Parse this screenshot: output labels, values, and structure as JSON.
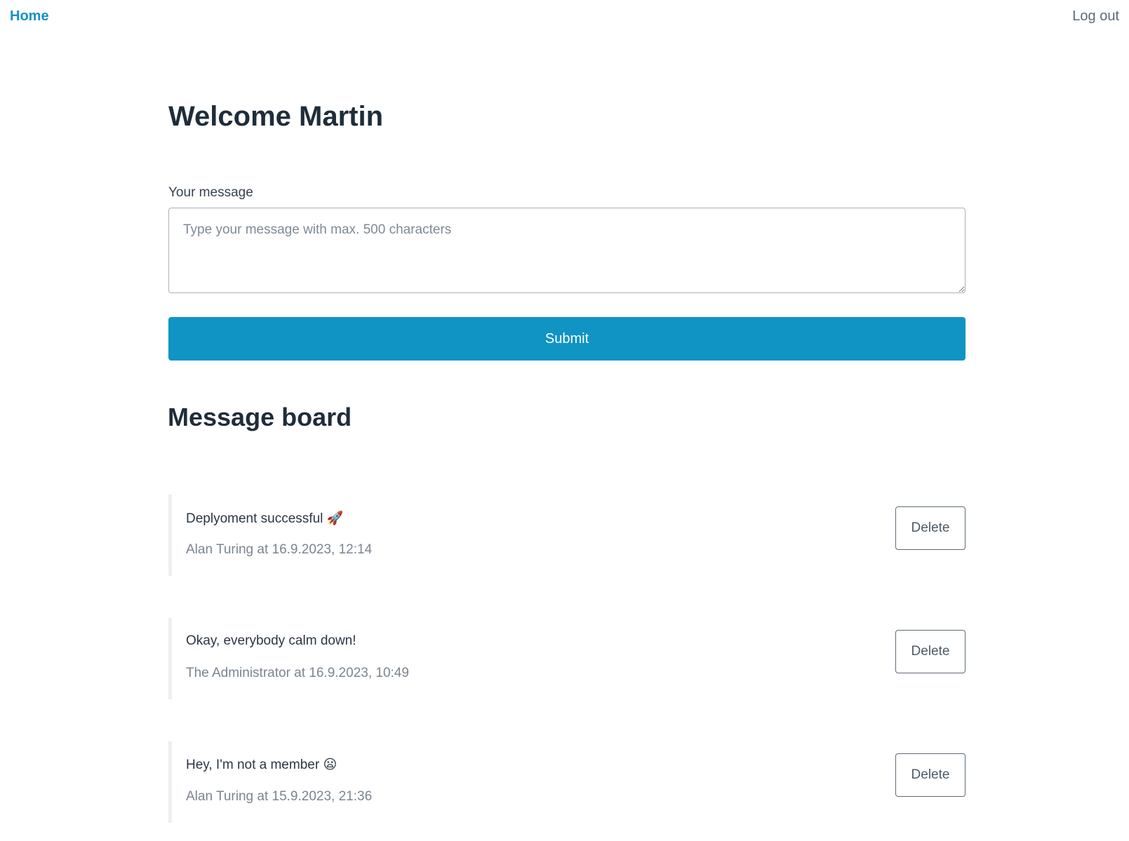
{
  "nav": {
    "home_label": "Home",
    "logout_label": "Log out"
  },
  "welcome": {
    "title": "Welcome Martin"
  },
  "form": {
    "label": "Your message",
    "placeholder": "Type your message with max. 500 characters",
    "value": "",
    "submit_label": "Submit"
  },
  "board": {
    "title": "Message board",
    "messages": [
      {
        "text": "Deplyoment successful 🚀",
        "meta": "Alan Turing at 16.9.2023, 12:14",
        "delete_label": "Delete"
      },
      {
        "text": "Okay, everybody calm down!",
        "meta": "The Administrator at 16.9.2023, 10:49",
        "delete_label": "Delete"
      },
      {
        "text": "Hey, I'm not a member 😦",
        "meta": "Alan Turing at 15.9.2023, 21:36",
        "delete_label": "Delete"
      }
    ]
  },
  "colors": {
    "accent": "#1094c4",
    "heading": "#1f2d3a",
    "muted": "#7a8590"
  }
}
